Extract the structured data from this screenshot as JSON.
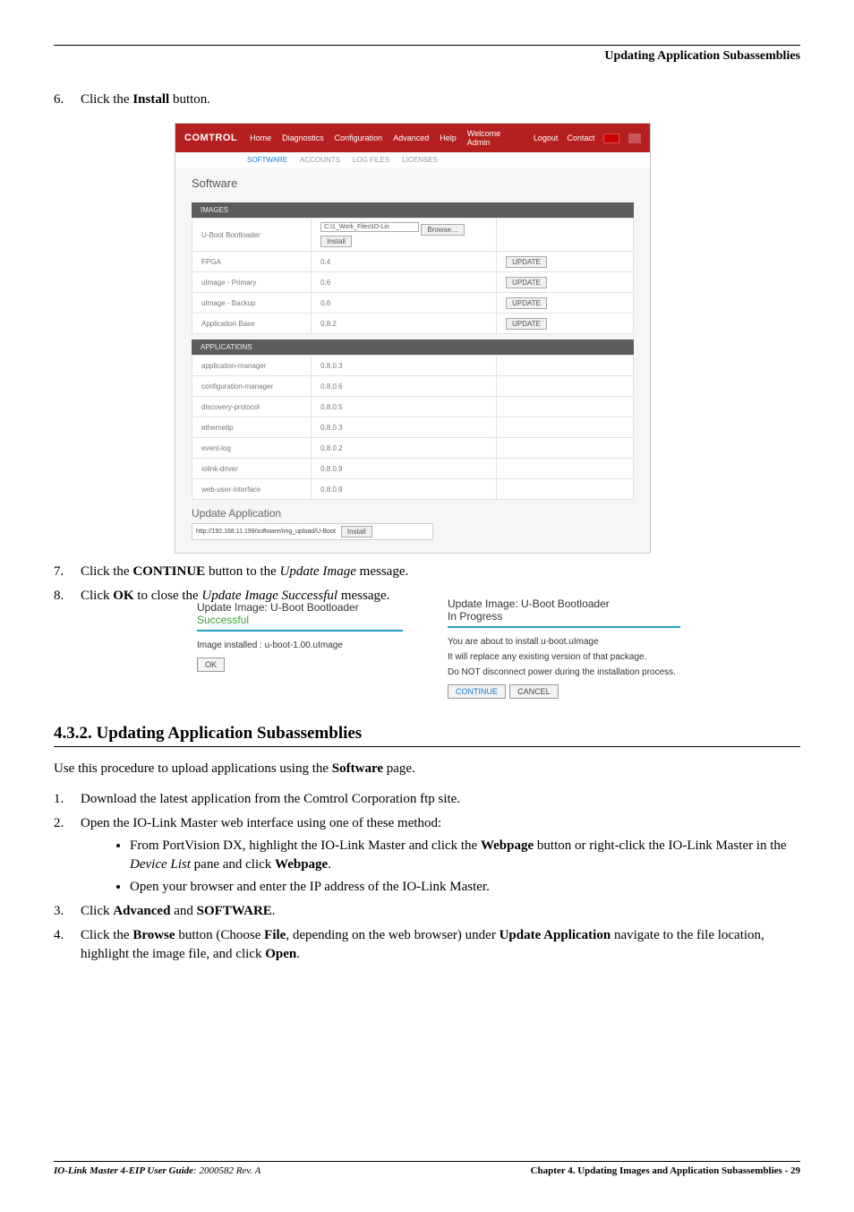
{
  "header": {
    "title": "Updating Application Subassemblies"
  },
  "step6": {
    "num": "6.",
    "text_a": "Click the ",
    "btn": "Install",
    "text_b": " button."
  },
  "screenshot": {
    "brand": "COMTROL",
    "nav": [
      "Home",
      "Diagnostics",
      "Configuration",
      "Advanced",
      "Help"
    ],
    "nav_right": {
      "welcome": "Welcome Admin",
      "logout": "Logout",
      "contact": "Contact"
    },
    "sub": {
      "active": "SOFTWARE",
      "items": [
        "ACCOUNTS",
        "LOG FILES",
        "LICENSES"
      ]
    },
    "panel_title": "Software",
    "images_hdr": "IMAGES",
    "images_rows": [
      {
        "name": "U-Boot Bootloader",
        "ver": "",
        "input": "C:\\1_Work_Files\\IO-Lin",
        "browse": "Browse…",
        "install": "Install"
      },
      {
        "name": "FPGA",
        "ver": "0.4",
        "update": "UPDATE"
      },
      {
        "name": "uImage - Primary",
        "ver": "0.6",
        "update": "UPDATE"
      },
      {
        "name": "uImage - Backup",
        "ver": "0.6",
        "update": "UPDATE"
      },
      {
        "name": "Application Base",
        "ver": "0.8.2",
        "update": "UPDATE"
      }
    ],
    "apps_hdr": "APPLICATIONS",
    "apps_rows": [
      {
        "name": "application-manager",
        "ver": "0.8.0.3"
      },
      {
        "name": "configuration-manager",
        "ver": "0.8.0.6"
      },
      {
        "name": "discovery-protocol",
        "ver": "0.8.0.5"
      },
      {
        "name": "ethernetip",
        "ver": "0.8.0.3"
      },
      {
        "name": "event-log",
        "ver": "0.8.0.2"
      },
      {
        "name": "iolink-driver",
        "ver": "0.8.0.9"
      },
      {
        "name": "web-user-interface",
        "ver": "0.8.0.9"
      }
    ],
    "update_app_title": "Update Application",
    "status_url": "http://192.168.11.199/software/img_upload/U-Boot",
    "status_btn": "Install"
  },
  "step7": {
    "num": "7.",
    "text_a": "Click the ",
    "btn": "CONTINUE",
    "text_b": " button to the ",
    "msg": "Update Image",
    "text_c": " message."
  },
  "step8": {
    "num": "8.",
    "text_a": "Click ",
    "btn": "OK",
    "text_b": " to close the ",
    "msg": "Update Image Successful",
    "text_c": " message."
  },
  "dlg_left": {
    "title_a": "Update Image: U-Boot Bootloader",
    "title_b": "Successful",
    "body": "Image installed : u-boot-1.00.uImage",
    "ok": "OK"
  },
  "dlg_right": {
    "title_a": "Update Image: U-Boot Bootloader",
    "title_b": "In Progress",
    "l1": "You are about to install u-boot.uImage",
    "l2": "It will replace any existing version of that package.",
    "l3": "Do NOT disconnect power during the installation process.",
    "cont": "CONTINUE",
    "cancel": "CANCEL"
  },
  "section_heading": "4.3.2. Updating Application Subassemblies",
  "body_intro_a": "Use this procedure to upload applications using the ",
  "body_intro_btn": "Software",
  "body_intro_b": " page.",
  "s1": {
    "num": "1.",
    "text": "Download the latest application from the Comtrol Corporation ftp site."
  },
  "s2": {
    "num": "2.",
    "text": "Open the IO-Link Master web interface using one of these method:"
  },
  "s2a": {
    "a": "From PortVision DX, highlight the IO-Link Master and click the ",
    "btn1": "Webpage",
    "b": " button or right-click the IO-Link Master in the ",
    "it": "Device List",
    "c": " pane and click ",
    "btn2": "Webpage",
    "d": "."
  },
  "s2b": "Open your browser and enter the IP address of the IO-Link Master.",
  "s3": {
    "num": "3.",
    "a": "Click ",
    "btn1": "Advanced",
    "b": " and ",
    "btn2": "SOFTWARE",
    "c": "."
  },
  "s4": {
    "num": "4.",
    "a": "Click the ",
    "btn1": "Browse",
    "b": " button (Choose ",
    "btn2": "File",
    "c": ", depending on the web browser) under ",
    "btn3": "Update Application",
    "d": " navigate to the file location, highlight the image file, and click ",
    "btn4": "Open",
    "e": "."
  },
  "footer_left_a": "IO-Link Master 4-EIP User Guide",
  "footer_left_b": ": 2000582 Rev. A",
  "footer_right_a": "Chapter 4. Updating Images and Application Subassemblies  - ",
  "footer_right_pg": "29"
}
